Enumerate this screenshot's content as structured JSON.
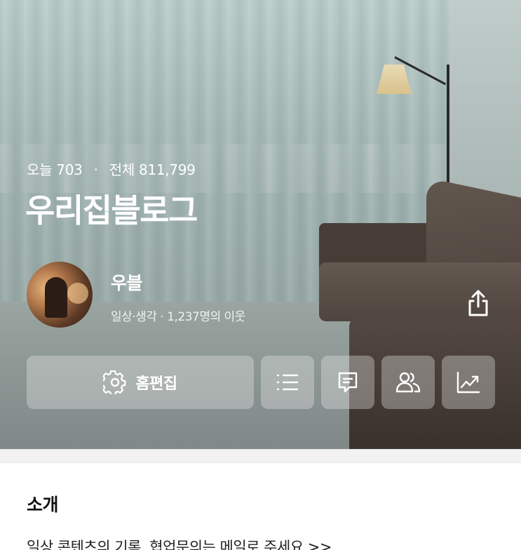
{
  "stats": {
    "today_label": "오늘",
    "today_value": "703",
    "separator": "·",
    "total_label": "전체",
    "total_value": "811,799"
  },
  "blog": {
    "title": "우리집블로그"
  },
  "profile": {
    "nickname": "우블",
    "meta": "일상·생각 · 1,237명의 이웃"
  },
  "actions": {
    "edit_label": "홈편집",
    "icons": [
      "gear-icon",
      "list-icon",
      "comment-icon",
      "neighbors-icon",
      "stats-icon",
      "share-icon"
    ]
  },
  "intro": {
    "title": "소개",
    "text": "일상 콘텐츠의 기록. 협업문의는 메일로 주세요 >>"
  },
  "colors": {
    "button_bg": "rgba(235,235,235,0.35)",
    "text_on_hero": "#ffffff",
    "divider": "#f2f2f2"
  }
}
